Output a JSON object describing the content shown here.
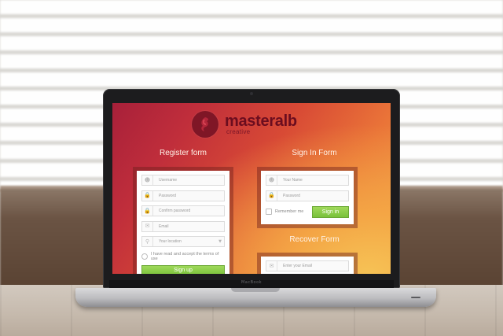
{
  "brand": {
    "name": "masteralb",
    "tagline": "creative"
  },
  "laptop": {
    "hinge_label": "MacBook"
  },
  "register_form": {
    "title": "Register form",
    "fields": [
      {
        "icon": "user-icon",
        "placeholder": "Username"
      },
      {
        "icon": "lock-icon",
        "placeholder": "Password"
      },
      {
        "icon": "lock-icon",
        "placeholder": "Confirm password"
      },
      {
        "icon": "mail-icon",
        "placeholder": "Email"
      },
      {
        "icon": "location-pin-icon",
        "placeholder": "Your location"
      }
    ],
    "terms_label": "I have read and accept the terms of use",
    "submit_label": "Sign up"
  },
  "signin_form": {
    "title": "Sign In Form",
    "fields": [
      {
        "icon": "user-icon",
        "placeholder": "Your Name"
      },
      {
        "icon": "lock-icon",
        "placeholder": "Password"
      }
    ],
    "remember_label": "Remember me",
    "submit_label": "Sign in"
  },
  "recover_form": {
    "title": "Recover Form",
    "fields": [
      {
        "icon": "mail-icon",
        "placeholder": "Enter your Email"
      }
    ]
  },
  "colors": {
    "accent_green": "#79c13a",
    "brand_dark_red": "#6b0d1f",
    "background_gradient_start": "#a8203a",
    "background_gradient_end": "#f1a046"
  }
}
